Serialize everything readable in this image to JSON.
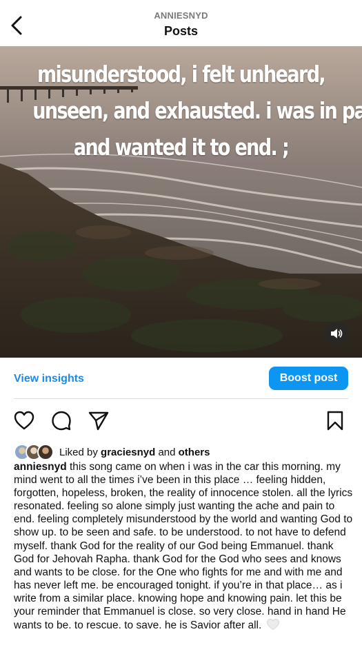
{
  "header": {
    "username": "ANNIESNYD",
    "title": "Posts"
  },
  "media": {
    "overlay_lines": [
      "misunderstood, i felt unheard,",
      "unseen, and exhausted. i was in pain",
      "and wanted it to end.  ;"
    ]
  },
  "actions": {
    "view_insights": "View insights",
    "boost_post": "Boost post"
  },
  "likes": {
    "prefix": "Liked by",
    "user": "graciesnyd",
    "connector": "and",
    "others": "others"
  },
  "caption": {
    "username": "anniesnyd",
    "text": "this song came on when i was in the car this morning. my mind went to all the times i’ve been in this place … feeling hidden, forgotten, hopeless, broken, the reality of innocence stolen. all the lyrics resonated. feeling so alone simply just wanting the ache and pain to end. feeling completely misunderstood by the world and wanting God to show up. to be seen and safe. to be understood. to not have to defend myself. thank God for the reality of our God being Emmanuel. thank God for Jehovah Rapha. thank God for the God who sees and knows and wants to be close. for the One who fights for me and with me and has never left me. be encouraged tonight. if you’re in that place… as i write from a similar place. knowing hope and knowing pain. let this be your reminder that Emmanuel is close. so very close. hand in hand He wants to be. to rescue. to save. he is Savior after all."
  },
  "icons": {
    "back": "chevron-left-icon",
    "sound": "speaker-icon",
    "like": "heart-icon",
    "comment": "comment-bubble-icon",
    "share": "paper-plane-icon",
    "save": "bookmark-icon",
    "caption_emoji": "white-heart-emoji"
  },
  "colors": {
    "accent": "#0d95f2",
    "link": "#1a8ae6"
  }
}
